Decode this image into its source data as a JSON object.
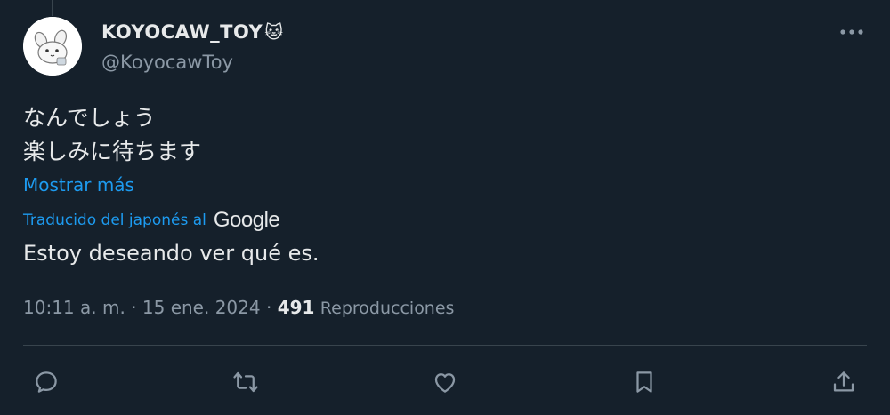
{
  "tweet": {
    "author": {
      "display_name": "KOYOCAW_TOY",
      "emoji": "🐱",
      "handle": "@KoyocawToy"
    },
    "text_lines": [
      "なんでしょう",
      "楽しみに待ちます"
    ],
    "show_more_label": "Mostrar más",
    "translation": {
      "label": "Traducido del japonés al",
      "provider": "Google",
      "text": "Estoy deseando ver qué es."
    },
    "meta": {
      "time": "10:11 a. m.",
      "separator": "·",
      "date": "15 ene. 2024",
      "views_count": "491",
      "views_label": "Reproducciones"
    }
  },
  "actions": {
    "reply_icon": "reply-icon",
    "retweet_icon": "retweet-icon",
    "like_icon": "like-icon",
    "bookmark_icon": "bookmark-icon",
    "share_icon": "share-icon"
  },
  "colors": {
    "background": "#15202b",
    "text": "#e7e9ea",
    "secondary": "#8b98a5",
    "link": "#1d9bf0",
    "divider": "#38444d"
  }
}
